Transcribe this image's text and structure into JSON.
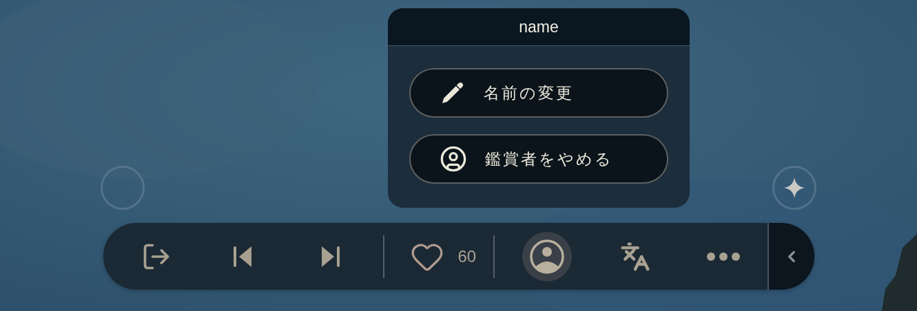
{
  "floating_buttons": [
    {
      "kind": "empty"
    },
    {
      "kind": "sparkle"
    }
  ],
  "popup": {
    "title": "name",
    "actions": [
      {
        "kind": "rename",
        "label": "名前の変更"
      },
      {
        "kind": "leave",
        "label": "鑑賞者をやめる"
      }
    ]
  },
  "toolbar": {
    "groups": [
      [
        {
          "kind": "exit",
          "selected": false
        },
        {
          "kind": "previous",
          "selected": false
        },
        {
          "kind": "next",
          "selected": false
        }
      ],
      [
        {
          "kind": "like",
          "selected": false,
          "count": "60"
        }
      ],
      [
        {
          "kind": "profile",
          "selected": true
        },
        {
          "kind": "translate",
          "selected": false
        },
        {
          "kind": "more",
          "selected": false
        }
      ]
    ],
    "collapse": {
      "kind": "collapse"
    }
  }
}
